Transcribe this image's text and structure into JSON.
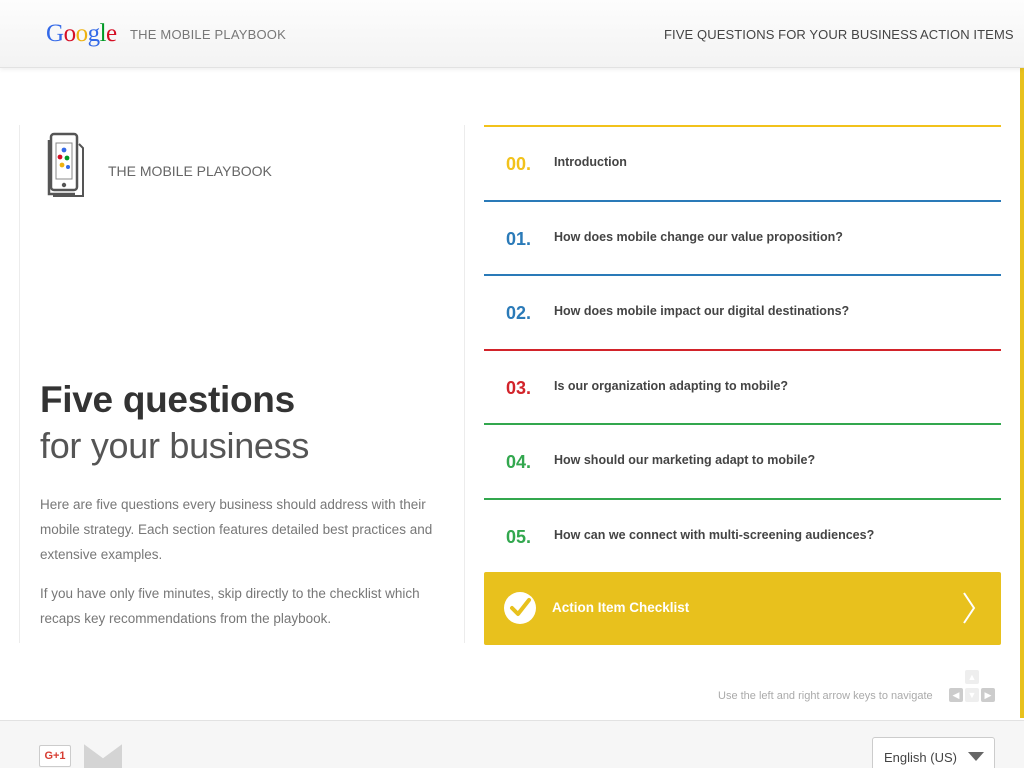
{
  "header": {
    "logo_letters": [
      {
        "ch": "G",
        "color": "#3369e8"
      },
      {
        "ch": "o",
        "color": "#d50f25"
      },
      {
        "ch": "o",
        "color": "#eeb211"
      },
      {
        "ch": "g",
        "color": "#3369e8"
      },
      {
        "ch": "l",
        "color": "#009925"
      },
      {
        "ch": "e",
        "color": "#d50f25"
      }
    ],
    "brand_title": "THE MOBILE PLAYBOOK",
    "nav": [
      "FIVE QUESTIONS FOR YOUR BUSINESS",
      "ACTION ITEMS"
    ]
  },
  "intro": {
    "book_icon": "mobile-book-icon",
    "book_label": "THE MOBILE PLAYBOOK",
    "headline_strong": "Five questions",
    "headline_light": "for your business",
    "paragraphs": [
      "Here are five questions every business should address with their mobile strategy. Each section features detailed best practices and extensive examples.",
      "If you have only five minutes, skip directly to the checklist which recaps key recommendations from the playbook."
    ]
  },
  "questions": [
    {
      "num": "00.",
      "text": "Introduction",
      "color": "#f2c21b"
    },
    {
      "num": "01.",
      "text": "How does mobile change our value proposition?",
      "color": "#2a7ab8"
    },
    {
      "num": "02.",
      "text": "How does mobile impact our digital destinations?",
      "color": "#2a7ab8"
    },
    {
      "num": "03.",
      "text": "Is our organization adapting to mobile?",
      "color": "#d2232a"
    },
    {
      "num": "04.",
      "text": "How should our marketing adapt to mobile?",
      "color": "#32a74e"
    },
    {
      "num": "05.",
      "text": "How can we connect with multi-screening audiences?",
      "color": "#32a74e"
    }
  ],
  "checklist": {
    "label": "Action Item Checklist",
    "check_icon": "checkmark-icon",
    "arrow_icon": "chevron-right-icon",
    "color": "#e8c11d"
  },
  "navigation": {
    "hint": "Use the left and right arrow keys to navigate",
    "keys": [
      "arrow-up-key",
      "arrow-left-key",
      "arrow-down-key",
      "arrow-right-key"
    ]
  },
  "footer": {
    "gplus_label": "G+1",
    "mail_icon": "mail-icon",
    "language": "English (US)"
  }
}
